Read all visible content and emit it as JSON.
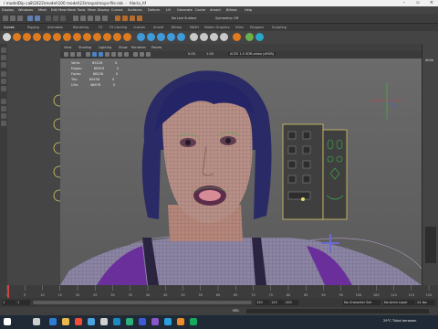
{
  "window": {
    "title_path": "/ modelDip ca8\\2022\\model\\100 model\\23\\maya\\maya-file.mb",
    "title_name": "Aleria_hf"
  },
  "menubar": {
    "items": [
      "Display",
      "Windows",
      "Mesh",
      "Edit Mesh",
      "Mesh Tools",
      "Mesh Display",
      "Curves",
      "Surfaces",
      "Deform",
      "UV",
      "Generate",
      "Cache",
      "Arnold",
      "Bifrost",
      "Help"
    ]
  },
  "statusline": {
    "objects_label": "No Live Surface",
    "symmetry_label": "Symmetry: Off"
  },
  "shelf": {
    "tabs": [
      "Curves",
      "Rigging",
      "Animation",
      "Rendering",
      "FX",
      "FX Caching",
      "Custom",
      "Arnold",
      "Bifrost",
      "MASH",
      "Motion Graphics",
      "XGen",
      "Polygons",
      "Sculpting",
      "Mesh",
      "Tools"
    ]
  },
  "viewport": {
    "menu": [
      "View",
      "Shading",
      "Lighting",
      "Show",
      "Renderer",
      "Panels"
    ],
    "color_space": "ACES 1.0 SDR-video (sRGB)",
    "gamma": "1.00",
    "exposure": "0.00",
    "hud_rows": [
      {
        "label": "Verts:",
        "value": "69228",
        "z": "0"
      },
      {
        "label": "Edges:",
        "value": "80903",
        "z": "0"
      },
      {
        "label": "Faces:",
        "value": "68228",
        "z": "0"
      },
      {
        "label": "Tris:",
        "value": "69458",
        "z": "0"
      },
      {
        "label": "UVs:",
        "value": "48878",
        "z": "0"
      }
    ]
  },
  "rightpanel": {
    "label": "Attrib"
  },
  "timeline": {
    "ticks": [
      "1",
      "5",
      "10",
      "15",
      "20",
      "25",
      "30",
      "35",
      "40",
      "45",
      "50",
      "55",
      "60",
      "65",
      "70",
      "75",
      "80",
      "85",
      "90",
      "95",
      "100",
      "105",
      "110",
      "115",
      "120"
    ],
    "current": "1"
  },
  "range": {
    "start": "1",
    "start_inner": "1",
    "end_inner": "120",
    "end": "120",
    "out": "200",
    "char_set": "No Character Set",
    "anim_layer": "No Anim Layer",
    "fps": "24 fps"
  },
  "cmdline": {
    "lang": "MEL"
  },
  "taskbar": {
    "weather": "29°C",
    "weather_desc": "Tidak berawan"
  }
}
